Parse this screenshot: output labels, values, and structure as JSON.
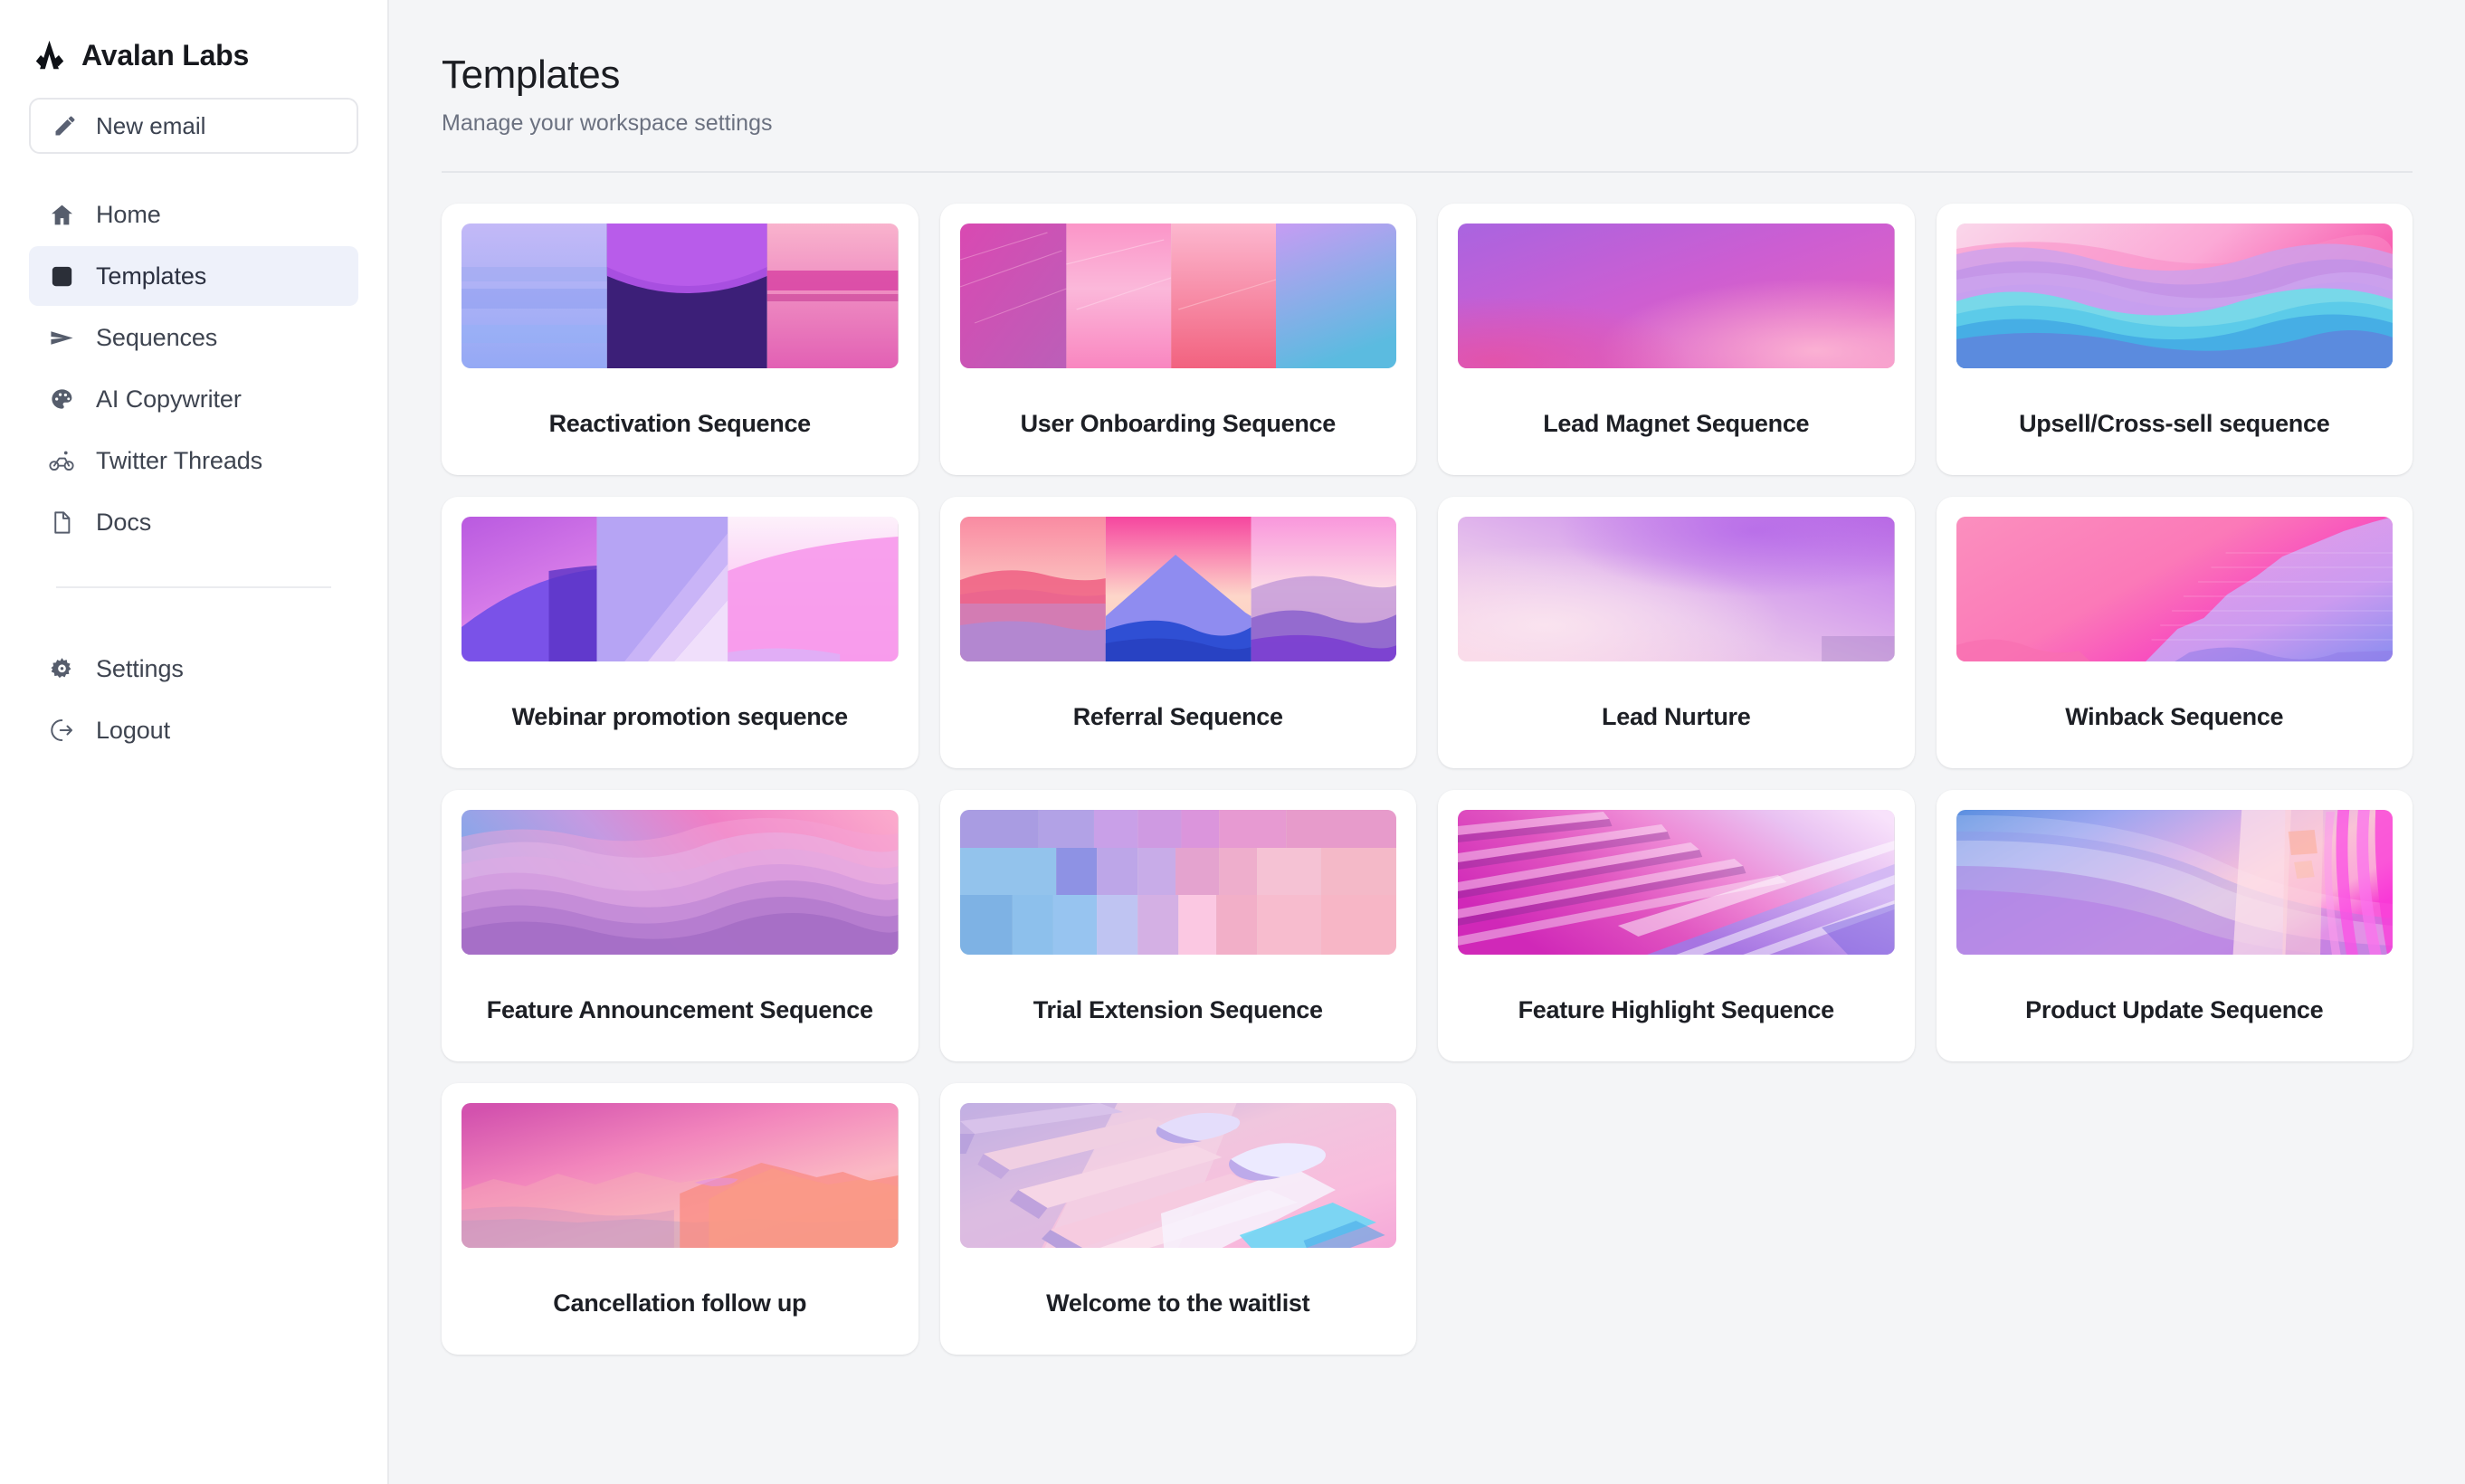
{
  "brand": {
    "name": "Avalan Labs",
    "logo_icon": "avalan-mark-icon"
  },
  "compose": {
    "label": "New email",
    "icon": "pencil-icon"
  },
  "sidebar": {
    "items": [
      {
        "label": "Home",
        "icon": "home-icon",
        "active": false
      },
      {
        "label": "Templates",
        "icon": "square-icon",
        "active": true
      },
      {
        "label": "Sequences",
        "icon": "send-icon",
        "active": false
      },
      {
        "label": "AI Copywriter",
        "icon": "palette-icon",
        "active": false
      },
      {
        "label": "Twitter Threads",
        "icon": "bicycle-icon",
        "active": false
      },
      {
        "label": "Docs",
        "icon": "document-icon",
        "active": false
      }
    ],
    "bottom_items": [
      {
        "label": "Settings",
        "icon": "gear-icon"
      },
      {
        "label": "Logout",
        "icon": "logout-icon"
      }
    ]
  },
  "header": {
    "title": "Templates",
    "subtitle": "Manage your workspace settings"
  },
  "colors": {
    "page_bg": "#f4f5f7",
    "card_bg": "#ffffff",
    "active_nav_bg": "#eef1fa",
    "text_primary": "#1d1f25",
    "text_muted": "#6b7180"
  },
  "templates": [
    {
      "label": "Reactivation Sequence",
      "art": "triptych-blue-purple-pink"
    },
    {
      "label": "User Onboarding Sequence",
      "art": "four-panels-pink-cyan"
    },
    {
      "label": "Lead Magnet Sequence",
      "art": "gradient-purple-pink"
    },
    {
      "label": "Upsell/Cross-sell sequence",
      "art": "layered-waves-pink-blue"
    },
    {
      "label": "Webinar promotion sequence",
      "art": "triptych-purple-lavender-pink"
    },
    {
      "label": "Referral Sequence",
      "art": "triptych-sunset-mountains"
    },
    {
      "label": "Lead Nurture",
      "art": "gradient-soft-pink-purple"
    },
    {
      "label": "Winback Sequence",
      "art": "diagonal-pink-lilac-ridge"
    },
    {
      "label": "Feature Announcement Sequence",
      "art": "rolling-hills-blue-pink"
    },
    {
      "label": "Trial Extension Sequence",
      "art": "pastel-tile-mosaic"
    },
    {
      "label": "Feature Highlight Sequence",
      "art": "diagonal-ribbons-magenta"
    },
    {
      "label": "Product Update Sequence",
      "art": "silk-curves-blue-magenta"
    },
    {
      "label": "Cancellation follow up",
      "art": "pink-sunset-mountains"
    },
    {
      "label": "Welcome to the waitlist",
      "art": "iso-pastel-slabs"
    }
  ]
}
